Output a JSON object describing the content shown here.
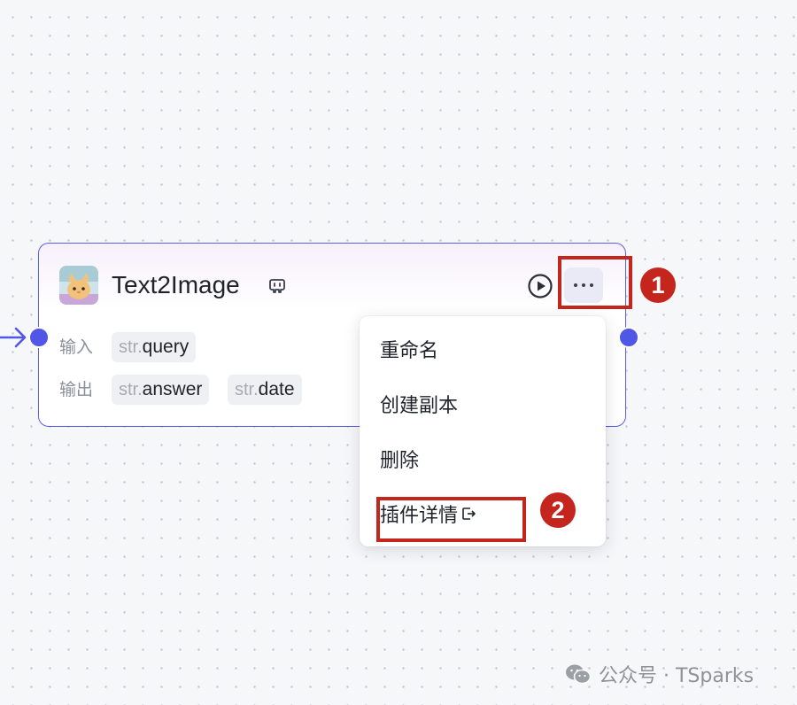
{
  "node": {
    "title": "Text2Image",
    "avatar_icon": "cat-plugin-avatar-icon",
    "type_icon": "plugin-icon",
    "run_icon": "play-circle-icon",
    "more_icon": "more-horizontal-icon",
    "inputs_label": "输入",
    "outputs_label": "输出",
    "inputs": [
      {
        "type": "str.",
        "name": "query"
      }
    ],
    "outputs": [
      {
        "type": "str.",
        "name": "answer"
      },
      {
        "type": "str.",
        "name": "date"
      }
    ]
  },
  "menu": {
    "items": [
      {
        "label": "重命名"
      },
      {
        "label": "创建副本"
      },
      {
        "label": "删除"
      },
      {
        "label": "插件详情",
        "icon": "external-link-icon"
      }
    ]
  },
  "annotations": {
    "marker_1": "1",
    "marker_2": "2"
  },
  "watermark": {
    "icon": "wechat-icon",
    "text": "公众号 · TSparks"
  },
  "colors": {
    "accent": "#5056e6",
    "node_border": "#5b5ee0",
    "annotation_red": "#c4251c",
    "canvas_bg": "#f6f7f9"
  }
}
